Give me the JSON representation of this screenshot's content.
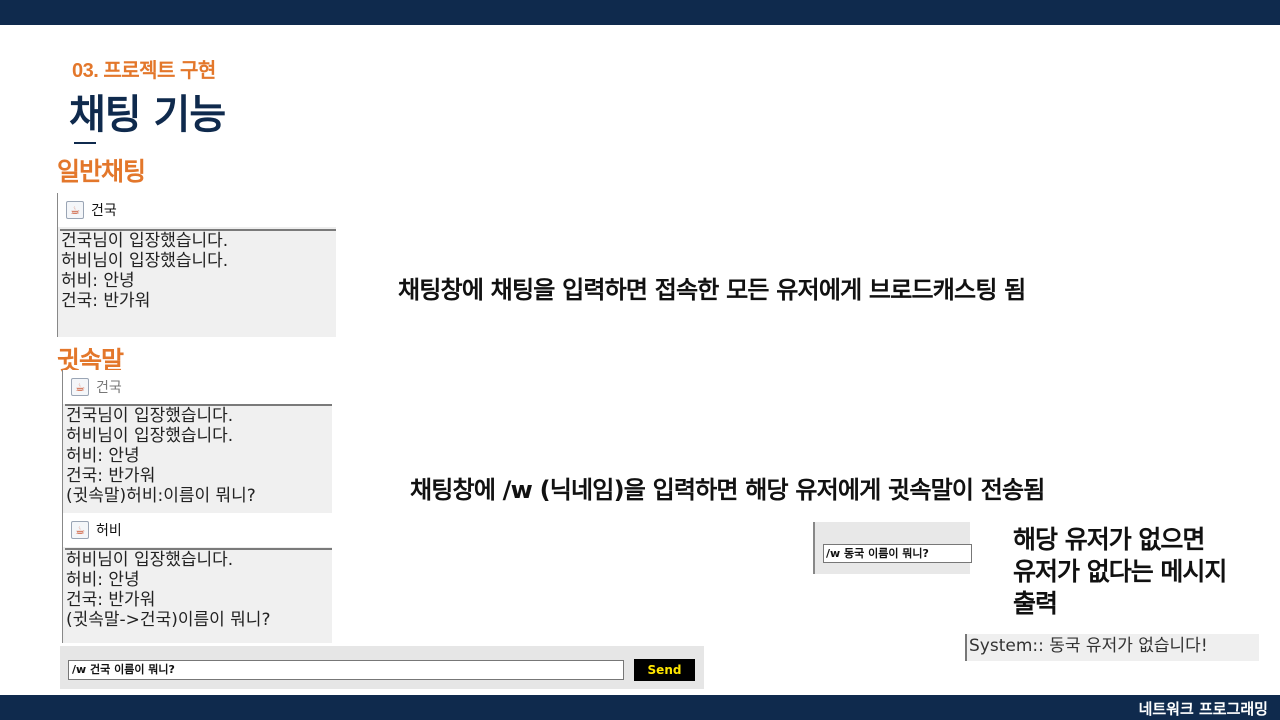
{
  "header": {
    "section": "03. 프로젝트 구현",
    "title": "채팅 기능"
  },
  "footer": {
    "label": "네트워크 프로그래밍"
  },
  "general_chat": {
    "heading": "일반채팅",
    "window": {
      "title": "건국",
      "lines": [
        "건국님이 입장했습니다.",
        "허비님이 입장했습니다.",
        "허비: 안녕",
        "건국: 반가워"
      ]
    },
    "description": "채팅창에 채팅을 입력하면 접속한 모든 유저에게 브로드캐스팅 됨"
  },
  "whisper": {
    "heading": "귓속말",
    "sender_window": {
      "title": "건국",
      "lines": [
        "건국님이 입장했습니다.",
        "허비님이 입장했습니다.",
        "허비: 안녕",
        "건국: 반가워",
        "(귓속말)허비:이름이 뭐니?"
      ]
    },
    "receiver_window": {
      "title": "허비",
      "lines": [
        "허비님이 입장했습니다.",
        "허비: 안녕",
        "건국: 반가워",
        "(귓속말->건국)이름이 뭐니?"
      ]
    },
    "description": "채팅창에 /w (닉네임)을 입력하면 해당 유저에게 귓속말이 전송됨",
    "input_value": "/w 건국 이름이 뭐니?",
    "send_label": "Send",
    "missing_input_value": "/w 동국 이름이 뭐니?",
    "missing_note": [
      "해당 유저가 없으면",
      "유저가 없다는 메시지",
      "출력"
    ],
    "system_message": "System:: 동국 유저가 없습니다!"
  }
}
